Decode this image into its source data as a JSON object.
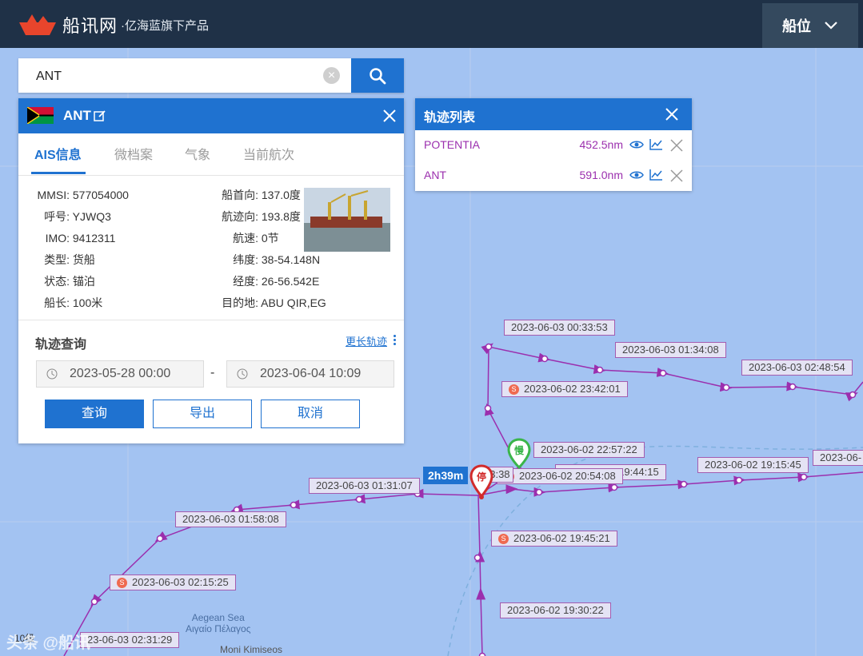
{
  "header": {
    "brand_name": "船讯网",
    "brand_sub": "·亿海蓝旗下产品",
    "position_button": "船位"
  },
  "search": {
    "value": "ANT"
  },
  "ship_panel": {
    "name": "ANT",
    "tabs": [
      "AIS信息",
      "微档案",
      "气象",
      "当前航次"
    ],
    "fields": {
      "mmsi_label": "MMSI:",
      "mmsi": "577054000",
      "callsign_label": "呼号:",
      "callsign": "YJWQ3",
      "imo_label": "IMO:",
      "imo": "9412311",
      "type_label": "类型:",
      "type": "货船",
      "status_label": "状态:",
      "status": "锚泊",
      "length_label": "船长:",
      "length": "100米",
      "heading_label": "船首向:",
      "heading": "137.0度",
      "course_label": "航迹向:",
      "course": "193.8度",
      "speed_label": "航速:",
      "speed": "0节",
      "lat_label": "纬度:",
      "lat": "38-54.148N",
      "lon_label": "经度:",
      "lon": "26-56.542E",
      "dest_label": "目的地:",
      "dest": "ABU QIR,EG"
    },
    "track_query": {
      "title": "轨迹查询",
      "more_link": "更长轨迹",
      "start": "2023-05-28 00:00",
      "end": "2023-06-04 10:09",
      "dash": "-",
      "query_button": "查询",
      "export_button": "导出",
      "cancel_button": "取消"
    }
  },
  "track_list": {
    "title": "轨迹列表",
    "items": [
      {
        "name": "POTENTIA",
        "distance": "452.5nm"
      },
      {
        "name": "ANT",
        "distance": "591.0nm"
      }
    ]
  },
  "map": {
    "labels": [
      "2023-06-03 00:33:53",
      "2023-06-03 01:34:08",
      "2023-06-03 02:48:54",
      "2023-06-02 23:42:01",
      "2023-06-02 22:57:22",
      "2023-06-02 19:15:45",
      "2023-06-",
      "2023-06-02 19:44:15",
      "2023-06-02 20:54:08",
      "2023-06-03 01:31:07",
      "2023-06-03 01:58:08",
      "2023-06-02 19:45:21",
      "2023-06-03 02:15:25",
      "2023-06-02 19:30:22",
      "23-06-03 02:31:29",
      "03:38"
    ],
    "duration": "2h39m",
    "pin_stop": "停",
    "pin_slow": "慢",
    "stop_badge": "S",
    "sea_name_en": "Aegean Sea",
    "sea_name_gr": "Αιγαίο Πέλαγος",
    "place": "Moni Kimiseos",
    "scale": "10级",
    "watermark": "头条 @船讯"
  },
  "colors": {
    "accent": "#1f72d0",
    "track": "#9b2fae",
    "header": "#1f3147"
  }
}
